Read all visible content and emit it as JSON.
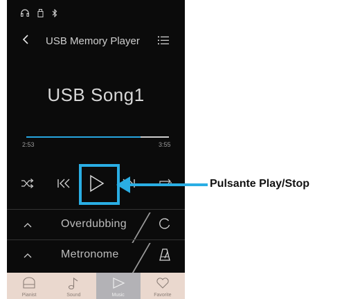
{
  "status_icons": [
    "headphones-icon",
    "usb-icon",
    "bluetooth-icon"
  ],
  "header": {
    "title": "USB Memory Player"
  },
  "song": {
    "name": "USB Song1"
  },
  "progress": {
    "elapsed": "2:53",
    "total": "3:55",
    "fraction": 0.8
  },
  "controls": [
    "shuffle-icon",
    "previous-icon",
    "play-icon",
    "next-icon",
    "repeat-icon"
  ],
  "rows": [
    {
      "label": "Overdubbing",
      "icon": "record-circle-icon"
    },
    {
      "label": "Metronome",
      "icon": "metronome-icon"
    }
  ],
  "tabs": [
    {
      "label": "Pianist",
      "icon": "piano-icon"
    },
    {
      "label": "Sound",
      "icon": "note-icon"
    },
    {
      "label": "Music",
      "icon": "play-icon",
      "active": true
    },
    {
      "label": "Favorite",
      "icon": "heart-icon"
    }
  ],
  "callout": {
    "text": "Pulsante Play/Stop"
  },
  "colors": {
    "accent": "#2aaee4",
    "background": "#0b0b0b",
    "tabbar": "#ead8ce",
    "tab_active": "#b3b2b6"
  }
}
